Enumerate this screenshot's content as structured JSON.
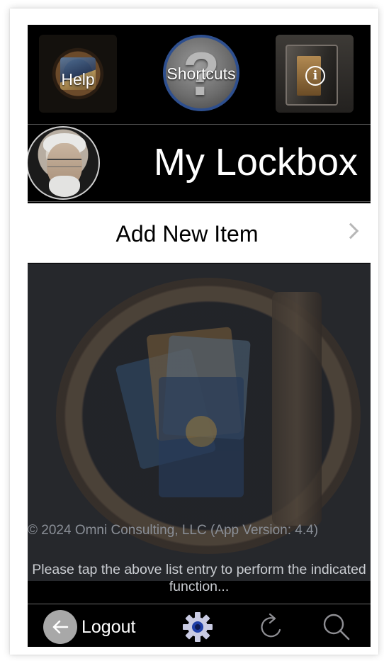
{
  "toolbar": {
    "help_label": "Help",
    "shortcuts_label": "Shortcuts",
    "shortcuts_glyph": "?",
    "info_glyph": "i"
  },
  "header": {
    "title": "My Lockbox"
  },
  "list": {
    "items": [
      {
        "label": "Add New Item"
      }
    ]
  },
  "content": {
    "copyright": "© 2024 Omni Consulting, LLC (App Version: 4.4)",
    "hint": "Please tap the above list entry to perform the indicated function..."
  },
  "tabbar": {
    "logout_label": "Logout",
    "icons": [
      "back-arrow-icon",
      "gear-icon",
      "refresh-icon",
      "search-icon"
    ]
  },
  "colors": {
    "background": "#000000",
    "list_row": "#ffffff",
    "shortcuts_ring": "#2e4f8e",
    "gear": "#c9cbe3"
  }
}
